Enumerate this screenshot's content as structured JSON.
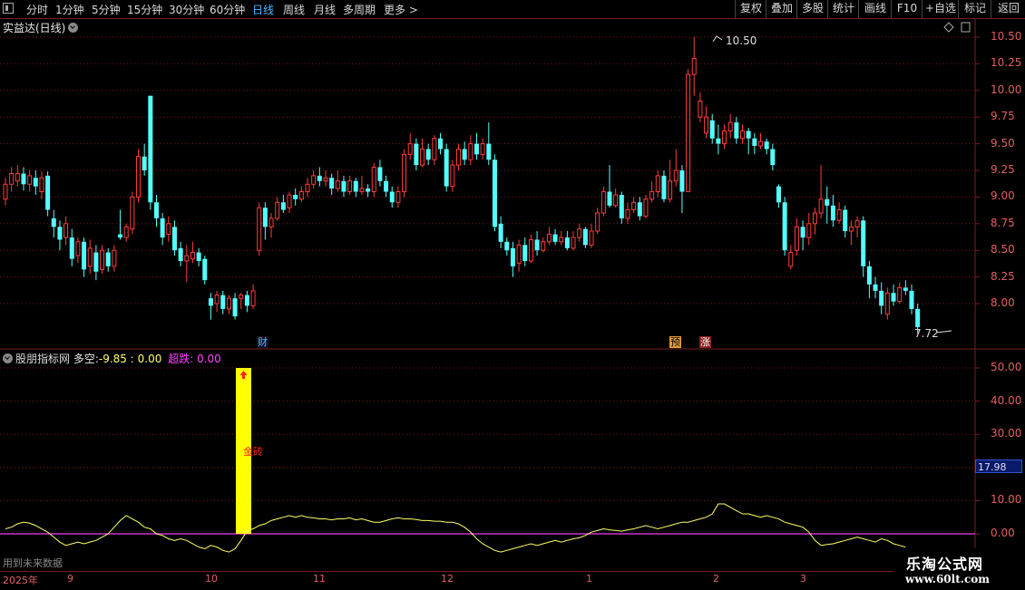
{
  "toolbar": {
    "periods": [
      "分时",
      "1分钟",
      "5分钟",
      "15分钟",
      "30分钟",
      "60分钟",
      "日线",
      "周线",
      "月线",
      "多周期",
      "更多 >"
    ],
    "active_period": "日线",
    "right_buttons": [
      "复权",
      "叠加",
      "多股",
      "统计",
      "画线",
      "F10",
      "+自选",
      "标记",
      "返回"
    ]
  },
  "price_panel": {
    "title": "实益达(日线)",
    "y_ticks": [
      "10.50",
      "10.25",
      "10.00",
      "9.75",
      "9.50",
      "9.25",
      "9.00",
      "8.75",
      "8.50",
      "8.25",
      "8.00"
    ],
    "high_label": "10.50",
    "low_label": "7.72",
    "event_tags": [
      "财",
      "预",
      "涨"
    ]
  },
  "indicator_panel": {
    "name": "股朋指标网",
    "label_duokong": "多空:",
    "value_duokong": "-9.85",
    "sep": ":",
    "value_second": "0.00",
    "label_chaodie": "超跌:",
    "value_chaodie": "0.00",
    "y_ticks": [
      "50.00",
      "40.00",
      "30.00",
      "20.00",
      "10.00",
      "0.00"
    ],
    "current_value": "17.98",
    "signal_text": "金砖"
  },
  "bottom_note": "用到未来数据",
  "time_axis": [
    "2025年",
    "9",
    "10",
    "11",
    "12",
    "1",
    "2",
    "3"
  ],
  "watermark": {
    "line1": "乐淘公式网",
    "line2": "www.60lt.com"
  },
  "colors": {
    "up": "#ff3b3b",
    "down": "#54ffff",
    "grid": "#7a1e1e",
    "line": "#ffff66",
    "zero": "#cc33cc",
    "signal": "#ffff00"
  },
  "chart_data": {
    "type": "candlestick",
    "ylim": [
      7.65,
      10.6
    ],
    "candles": [
      [
        8.98,
        9.12,
        9.18,
        8.92
      ],
      [
        9.12,
        9.22,
        9.28,
        9.05
      ],
      [
        9.15,
        9.22,
        9.3,
        9.1
      ],
      [
        9.22,
        9.12,
        9.28,
        9.06
      ],
      [
        9.12,
        9.2,
        9.25,
        9.05
      ],
      [
        9.18,
        9.1,
        9.25,
        9.02
      ],
      [
        9.05,
        9.18,
        9.24,
        8.98
      ],
      [
        9.2,
        8.88,
        9.24,
        8.82
      ],
      [
        8.8,
        8.72,
        8.88,
        8.62
      ],
      [
        8.72,
        8.6,
        8.78,
        8.5
      ],
      [
        8.62,
        8.75,
        8.82,
        8.55
      ],
      [
        8.62,
        8.42,
        8.7,
        8.35
      ],
      [
        8.45,
        8.58,
        8.62,
        8.38
      ],
      [
        8.58,
        8.32,
        8.62,
        8.25
      ],
      [
        8.35,
        8.52,
        8.6,
        8.28
      ],
      [
        8.48,
        8.3,
        8.55,
        8.22
      ],
      [
        8.32,
        8.5,
        8.55,
        8.28
      ],
      [
        8.48,
        8.35,
        8.52,
        8.3
      ],
      [
        8.35,
        8.5,
        8.55,
        8.3
      ],
      [
        8.65,
        8.62,
        8.88,
        8.6
      ],
      [
        8.62,
        8.72,
        8.75,
        8.58
      ],
      [
        8.7,
        9.0,
        9.05,
        8.65
      ],
      [
        9.0,
        9.38,
        9.45,
        8.95
      ],
      [
        9.38,
        9.25,
        9.5,
        9.2
      ],
      [
        9.95,
        8.95,
        9.95,
        8.88
      ],
      [
        8.95,
        8.8,
        9.02,
        8.72
      ],
      [
        8.8,
        8.62,
        8.85,
        8.55
      ],
      [
        8.65,
        8.75,
        8.82,
        8.58
      ],
      [
        8.72,
        8.5,
        8.78,
        8.45
      ],
      [
        8.52,
        8.4,
        8.58,
        8.35
      ],
      [
        8.4,
        8.45,
        8.55,
        8.2
      ],
      [
        8.42,
        8.48,
        8.58,
        8.38
      ],
      [
        8.48,
        8.4,
        8.52,
        8.35
      ],
      [
        8.42,
        8.22,
        8.45,
        8.18
      ],
      [
        8.05,
        7.98,
        8.1,
        7.85
      ],
      [
        8.0,
        8.08,
        8.12,
        7.92
      ],
      [
        8.08,
        7.95,
        8.12,
        7.9
      ],
      [
        7.95,
        8.05,
        8.08,
        7.9
      ],
      [
        8.05,
        7.88,
        8.1,
        7.85
      ],
      [
        8.05,
        8.08,
        8.1,
        7.95
      ],
      [
        8.08,
        7.98,
        8.12,
        7.92
      ],
      [
        7.98,
        8.12,
        8.18,
        7.95
      ],
      [
        8.5,
        8.9,
        8.95,
        8.45
      ],
      [
        8.9,
        8.72,
        8.95,
        8.6
      ],
      [
        8.72,
        8.8,
        8.85,
        8.62
      ],
      [
        8.8,
        8.95,
        9.0,
        8.78
      ],
      [
        8.95,
        8.88,
        9.02,
        8.85
      ],
      [
        8.9,
        9.02,
        9.05,
        8.85
      ],
      [
        9.02,
        8.98,
        9.08,
        8.92
      ],
      [
        8.98,
        9.05,
        9.1,
        8.95
      ],
      [
        9.05,
        9.12,
        9.18,
        9.0
      ],
      [
        9.12,
        9.2,
        9.25,
        9.08
      ],
      [
        9.2,
        9.15,
        9.28,
        9.1
      ],
      [
        9.15,
        9.18,
        9.25,
        9.1
      ],
      [
        9.18,
        9.08,
        9.22,
        9.02
      ],
      [
        9.08,
        9.15,
        9.25,
        9.05
      ],
      [
        9.15,
        9.05,
        9.2,
        9.0
      ],
      [
        9.05,
        9.15,
        9.2,
        9.02
      ],
      [
        9.15,
        9.05,
        9.18,
        9.0
      ],
      [
        9.05,
        9.08,
        9.2,
        9.02
      ],
      [
        9.08,
        9.05,
        9.12,
        9.0
      ],
      [
        9.05,
        9.28,
        9.32,
        9.0
      ],
      [
        9.28,
        9.15,
        9.35,
        9.1
      ],
      [
        9.15,
        9.05,
        9.2,
        9.0
      ],
      [
        9.05,
        8.95,
        9.1,
        8.9
      ],
      [
        8.95,
        9.05,
        9.1,
        8.9
      ],
      [
        9.05,
        9.4,
        9.45,
        9.0
      ],
      [
        9.4,
        9.5,
        9.6,
        9.35
      ],
      [
        9.5,
        9.3,
        9.55,
        9.25
      ],
      [
        9.3,
        9.45,
        9.55,
        9.28
      ],
      [
        9.45,
        9.35,
        9.5,
        9.3
      ],
      [
        9.35,
        9.55,
        9.58,
        9.3
      ],
      [
        9.55,
        9.45,
        9.6,
        9.4
      ],
      [
        9.45,
        9.1,
        9.5,
        9.05
      ],
      [
        9.1,
        9.3,
        9.35,
        9.05
      ],
      [
        9.3,
        9.45,
        9.5,
        9.25
      ],
      [
        9.45,
        9.35,
        9.52,
        9.3
      ],
      [
        9.35,
        9.5,
        9.58,
        9.3
      ],
      [
        9.5,
        9.4,
        9.6,
        9.35
      ],
      [
        9.4,
        9.5,
        9.55,
        9.35
      ],
      [
        9.5,
        9.35,
        9.7,
        9.3
      ],
      [
        9.35,
        8.72,
        9.4,
        8.68
      ],
      [
        8.75,
        8.58,
        8.82,
        8.52
      ],
      [
        8.58,
        8.5,
        8.62,
        8.45
      ],
      [
        8.52,
        8.35,
        8.58,
        8.25
      ],
      [
        8.38,
        8.55,
        8.6,
        8.3
      ],
      [
        8.55,
        8.4,
        8.62,
        8.35
      ],
      [
        8.4,
        8.6,
        8.65,
        8.38
      ],
      [
        8.6,
        8.5,
        8.68,
        8.45
      ],
      [
        8.5,
        8.58,
        8.62,
        8.48
      ],
      [
        8.58,
        8.65,
        8.72,
        8.55
      ],
      [
        8.65,
        8.58,
        8.7,
        8.55
      ],
      [
        8.58,
        8.62,
        8.68,
        8.55
      ],
      [
        8.62,
        8.52,
        8.68,
        8.5
      ],
      [
        8.52,
        8.62,
        8.68,
        8.5
      ],
      [
        8.62,
        8.7,
        8.75,
        8.58
      ],
      [
        8.7,
        8.55,
        8.72,
        8.52
      ],
      [
        8.55,
        8.68,
        8.75,
        8.52
      ],
      [
        8.68,
        8.85,
        8.9,
        8.65
      ],
      [
        8.85,
        9.05,
        9.1,
        8.82
      ],
      [
        9.05,
        8.92,
        9.3,
        8.9
      ],
      [
        8.92,
        9.02,
        9.08,
        8.9
      ],
      [
        9.02,
        8.8,
        9.05,
        8.75
      ],
      [
        8.8,
        8.88,
        8.95,
        8.75
      ],
      [
        8.88,
        8.95,
        9.0,
        8.85
      ],
      [
        8.95,
        8.82,
        9.0,
        8.78
      ],
      [
        8.82,
        8.98,
        9.02,
        8.8
      ],
      [
        8.98,
        9.05,
        9.15,
        8.95
      ],
      [
        9.05,
        9.2,
        9.25,
        9.0
      ],
      [
        9.2,
        8.98,
        9.25,
        8.95
      ],
      [
        8.98,
        9.15,
        9.35,
        8.95
      ],
      [
        9.15,
        9.25,
        9.45,
        9.1
      ],
      [
        9.25,
        9.05,
        9.3,
        8.85
      ],
      [
        9.05,
        10.15,
        10.2,
        9.05
      ],
      [
        10.15,
        10.3,
        10.5,
        9.95
      ],
      [
        9.75,
        9.9,
        9.98,
        9.7
      ],
      [
        9.6,
        9.75,
        9.85,
        9.55
      ],
      [
        9.72,
        9.55,
        9.78,
        9.5
      ],
      [
        9.55,
        9.5,
        9.68,
        9.4
      ],
      [
        9.5,
        9.62,
        9.68,
        9.45
      ],
      [
        9.62,
        9.7,
        9.78,
        9.55
      ],
      [
        9.7,
        9.55,
        9.75,
        9.5
      ],
      [
        9.55,
        9.62,
        9.68,
        9.5
      ],
      [
        9.62,
        9.55,
        9.65,
        9.4
      ],
      [
        9.55,
        9.48,
        9.6,
        9.4
      ],
      [
        9.48,
        9.52,
        9.6,
        9.45
      ],
      [
        9.52,
        9.45,
        9.55,
        9.4
      ],
      [
        9.45,
        9.3,
        9.5,
        9.25
      ],
      [
        9.1,
        8.95,
        9.12,
        8.9
      ],
      [
        8.95,
        8.5,
        9.0,
        8.45
      ],
      [
        8.35,
        8.48,
        8.55,
        8.32
      ],
      [
        8.5,
        8.72,
        8.8,
        8.45
      ],
      [
        8.72,
        8.62,
        8.78,
        8.5
      ],
      [
        8.62,
        8.75,
        8.85,
        8.55
      ],
      [
        8.75,
        8.85,
        8.9,
        8.65
      ],
      [
        8.85,
        8.98,
        9.3,
        8.8
      ],
      [
        8.98,
        8.92,
        9.1,
        8.75
      ],
      [
        8.92,
        8.78,
        9.02,
        8.72
      ],
      [
        8.78,
        8.88,
        8.95,
        8.75
      ],
      [
        8.88,
        8.68,
        8.92,
        8.62
      ],
      [
        8.68,
        8.72,
        8.78,
        8.55
      ],
      [
        8.72,
        8.78,
        8.82,
        8.62
      ],
      [
        8.78,
        8.35,
        8.82,
        8.25
      ],
      [
        8.35,
        8.18,
        8.4,
        8.05
      ],
      [
        8.18,
        8.12,
        8.25,
        8.05
      ],
      [
        8.12,
        7.98,
        8.2,
        7.9
      ],
      [
        7.9,
        8.1,
        8.15,
        7.85
      ],
      [
        8.1,
        8.02,
        8.18,
        7.98
      ],
      [
        8.02,
        8.15,
        8.2,
        8.0
      ],
      [
        8.15,
        8.12,
        8.22,
        8.08
      ],
      [
        8.12,
        7.95,
        8.18,
        7.9
      ],
      [
        7.95,
        7.78,
        8.0,
        7.72
      ]
    ],
    "indicator_line": [
      1.5,
      2,
      3,
      3.5,
      3.2,
      2.5,
      1.5,
      0.5,
      -1,
      -2.5,
      -3.5,
      -3,
      -2.5,
      -3,
      -2.5,
      -2,
      -1,
      0,
      2,
      4,
      5.5,
      4.5,
      3.5,
      2,
      1.5,
      0,
      -0.5,
      -1.5,
      -2,
      -1.5,
      -2,
      -3,
      -4,
      -4.5,
      -3.5,
      -4,
      -5,
      -5.5,
      -4.5,
      -2,
      1,
      1.5,
      2.5,
      3,
      4,
      4.5,
      5,
      5.5,
      5,
      5.5,
      5,
      4.8,
      4.5,
      4.5,
      4.2,
      4.5,
      4.5,
      4.8,
      4.2,
      4.5,
      4,
      3.5,
      3.5,
      4,
      4.5,
      4.8,
      4.5,
      4.5,
      4.3,
      4,
      4,
      3.8,
      3.8,
      3.5,
      3.5,
      3,
      2,
      0.5,
      -1.5,
      -3,
      -4,
      -5,
      -5.5,
      -5,
      -4.5,
      -4,
      -3.5,
      -3,
      -3.5,
      -3,
      -2.5,
      -2,
      -2.5,
      -2,
      -1.5,
      -1.2,
      -0.5,
      0.5,
      1,
      1.5,
      1.2,
      1,
      0.8,
      1.2,
      1.5,
      2,
      2.5,
      2,
      1.5,
      2,
      2.5,
      3,
      3.5,
      3.5,
      4,
      4.5,
      5,
      6,
      9,
      9,
      8,
      7,
      6,
      6,
      5.5,
      5,
      5.5,
      5,
      4.5,
      3.5,
      3,
      2.5,
      2,
      0.5,
      -2,
      -3.5,
      -3.2,
      -3,
      -2.5,
      -2,
      -1.5,
      -1,
      -1.5,
      -2,
      -2.5,
      -1.5,
      -2,
      -3,
      -3.5,
      -4
    ],
    "signal_index": 33
  }
}
